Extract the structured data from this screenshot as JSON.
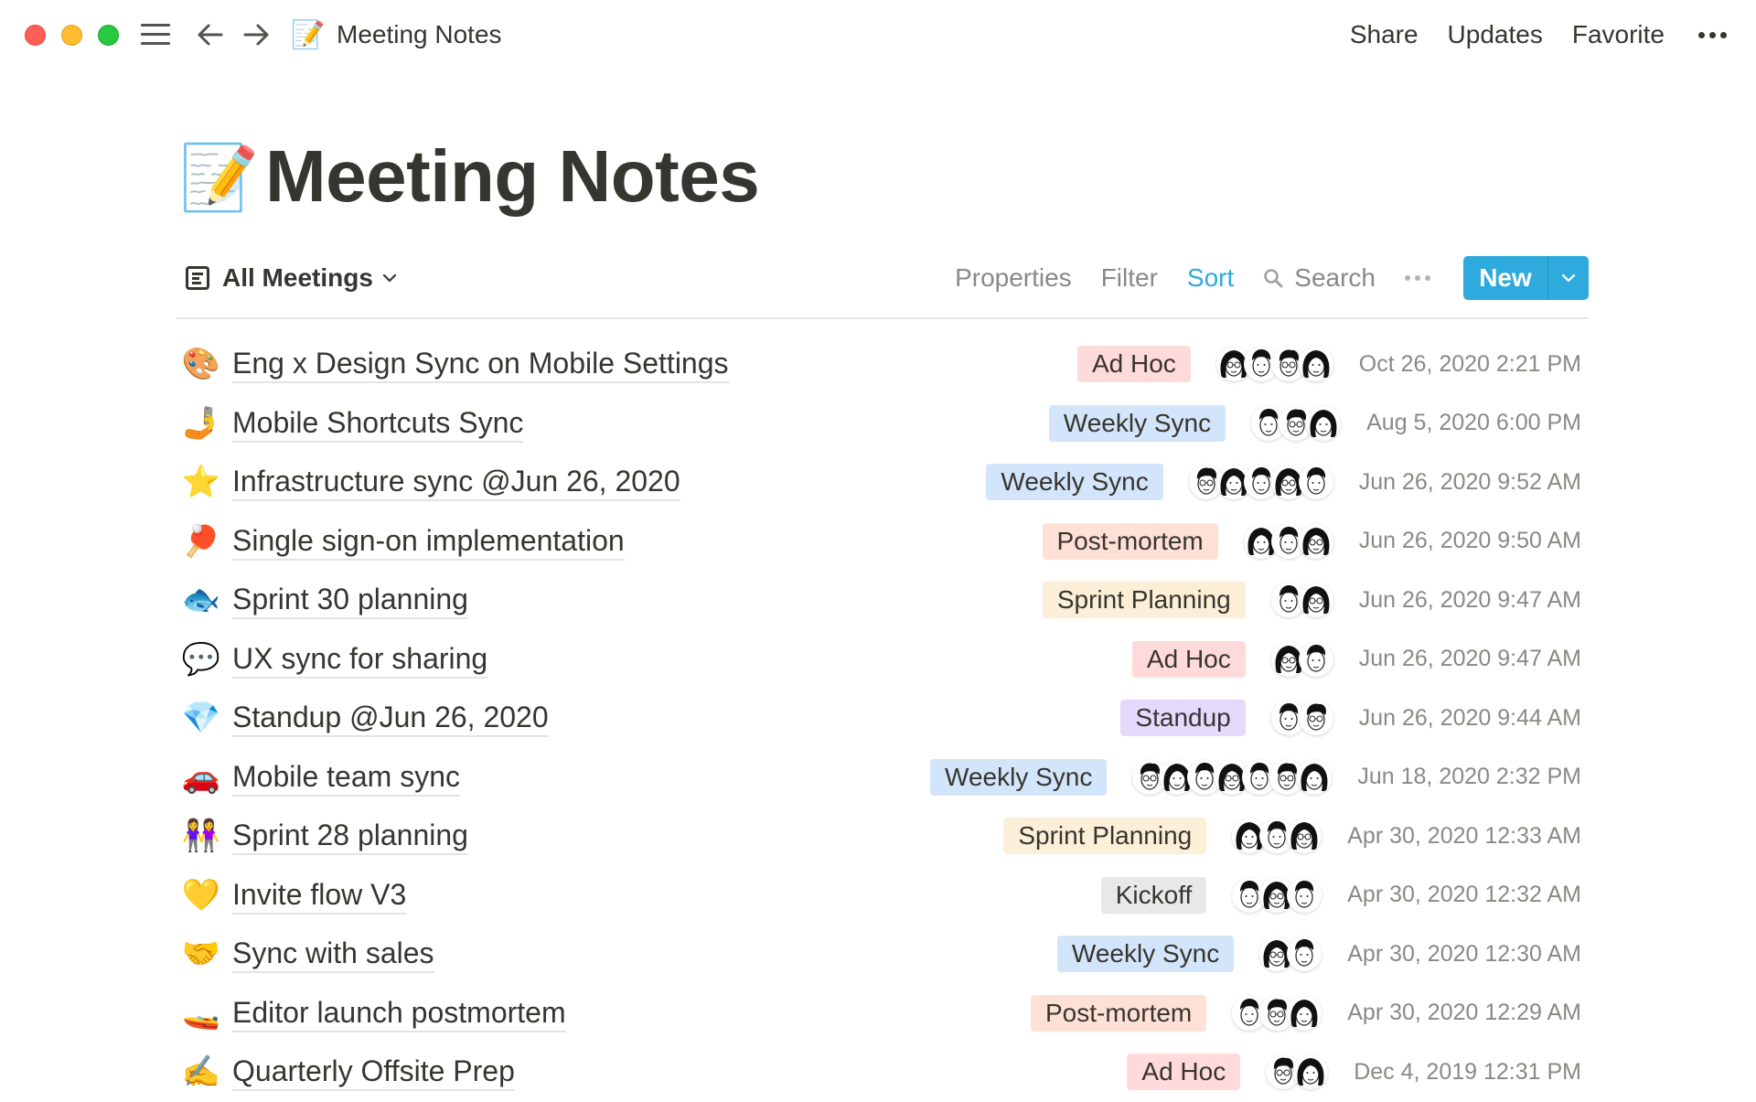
{
  "window": {
    "breadcrumb_emoji": "📝",
    "breadcrumb_title": "Meeting Notes",
    "actions": [
      "Share",
      "Updates",
      "Favorite"
    ]
  },
  "page": {
    "icon": "📝",
    "title": "Meeting Notes"
  },
  "view": {
    "name": "All Meetings",
    "toolbar": {
      "properties": "Properties",
      "filter": "Filter",
      "sort": "Sort",
      "search": "Search",
      "new": "New"
    }
  },
  "colors": {
    "accent": "#2eaadc",
    "tags": {
      "Ad Hoc": "#ffdadb",
      "Weekly Sync": "#d3e5fa",
      "Post-mortem": "#ffe0d6",
      "Sprint Planning": "#fcefd8",
      "Standup": "#e6dafc",
      "Kickoff": "#e8e8e6"
    }
  },
  "meetings": [
    {
      "emoji": "🎨",
      "title": "Eng x Design Sync on Mobile Settings",
      "type": "Ad Hoc",
      "attendees": 4,
      "created": "Oct 26, 2020 2:21 PM"
    },
    {
      "emoji": "🤳",
      "title": "Mobile Shortcuts Sync",
      "type": "Weekly Sync",
      "attendees": 3,
      "created": "Aug 5, 2020 6:00 PM"
    },
    {
      "emoji": "⭐",
      "title": "Infrastructure sync @Jun 26, 2020",
      "type": "Weekly Sync",
      "attendees": 5,
      "created": "Jun 26, 2020 9:52 AM"
    },
    {
      "emoji": "🏓",
      "title": "Single sign-on implementation",
      "type": "Post-mortem",
      "attendees": 3,
      "created": "Jun 26, 2020 9:50 AM"
    },
    {
      "emoji": "🐟",
      "title": "Sprint 30 planning",
      "type": "Sprint Planning",
      "attendees": 2,
      "created": "Jun 26, 2020 9:47 AM"
    },
    {
      "emoji": "💬",
      "title": "UX sync for sharing",
      "type": "Ad Hoc",
      "attendees": 2,
      "created": "Jun 26, 2020 9:47 AM"
    },
    {
      "emoji": "💎",
      "title": "Standup @Jun 26, 2020",
      "type": "Standup",
      "attendees": 2,
      "created": "Jun 26, 2020 9:44 AM"
    },
    {
      "emoji": "🚗",
      "title": "Mobile team sync",
      "type": "Weekly Sync",
      "attendees": 7,
      "created": "Jun 18, 2020 2:32 PM"
    },
    {
      "emoji": "👭",
      "title": "Sprint 28 planning",
      "type": "Sprint Planning",
      "attendees": 3,
      "created": "Apr 30, 2020 12:33 AM"
    },
    {
      "emoji": "💛",
      "title": "Invite flow V3",
      "type": "Kickoff",
      "attendees": 3,
      "created": "Apr 30, 2020 12:32 AM"
    },
    {
      "emoji": "🤝",
      "title": "Sync with sales",
      "type": "Weekly Sync",
      "attendees": 2,
      "created": "Apr 30, 2020 12:30 AM"
    },
    {
      "emoji": "🚤",
      "title": "Editor launch postmortem",
      "type": "Post-mortem",
      "attendees": 3,
      "created": "Apr 30, 2020 12:29 AM"
    },
    {
      "emoji": "✍️",
      "title": "Quarterly Offsite Prep",
      "type": "Ad Hoc",
      "attendees": 2,
      "created": "Dec 4, 2019 12:31 PM"
    }
  ]
}
